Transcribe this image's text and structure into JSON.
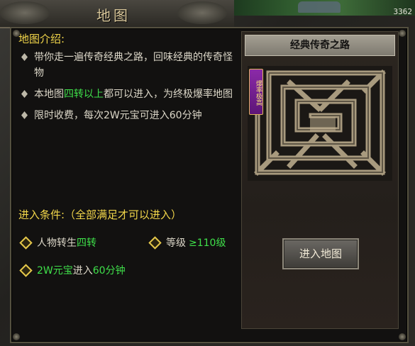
{
  "window": {
    "title": "地图",
    "coordinate": "3362"
  },
  "intro": {
    "heading": "地图介绍:",
    "bullets": [
      {
        "text": "带你走一遍传奇经典之路，回味经典的传奇怪物"
      },
      {
        "pre": "本地图",
        "highlight": "四转以上",
        "post": "都可以进入，为终极爆率地图"
      },
      {
        "text": "限时收费，每次2W元宝可进入60分钟"
      }
    ]
  },
  "conditions": {
    "heading": "进入条件:（全部满足才可以进入）",
    "items": [
      {
        "pre": "人物转生",
        "highlight": "四转",
        "post": ""
      },
      {
        "pre": "等级",
        "highlight": "≥110级",
        "post": ""
      },
      {
        "pre": "",
        "highlight": "2W元宝",
        "post": "进入",
        "highlight2": "60分钟"
      }
    ]
  },
  "map_panel": {
    "name": "经典传奇之路",
    "badge": "爆率极高"
  },
  "enter_button": {
    "label": "进入地图"
  },
  "colors": {
    "accent_yellow": "#f2d64a",
    "highlight_green": "#3fe04a",
    "text": "#dcd7c8"
  }
}
